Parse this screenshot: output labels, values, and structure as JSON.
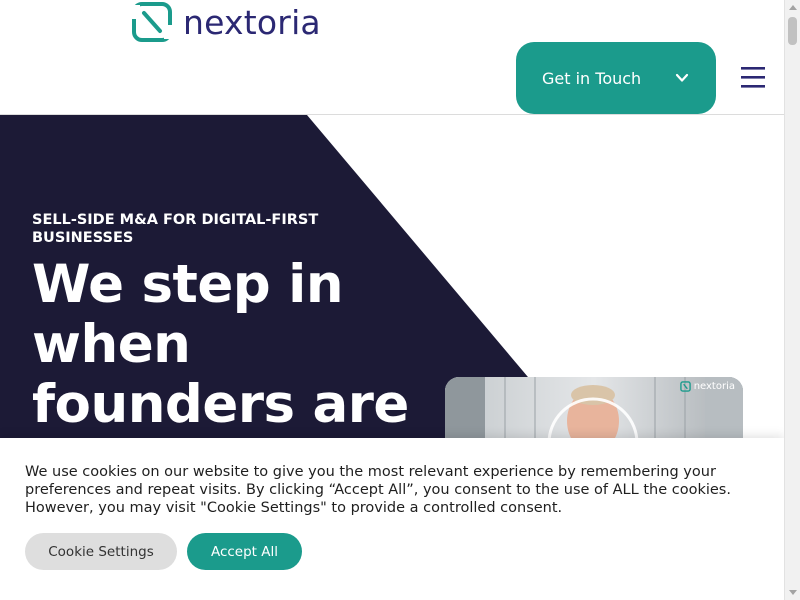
{
  "brand": {
    "name": "nextoria",
    "accent": "#1b9b8c",
    "navy": "#1c1a36",
    "wordmark_color": "#2b2873"
  },
  "header": {
    "cta_label": "Get in Touch",
    "cta_icon": "chevron-down-icon",
    "menu_icon": "hamburger-menu-icon"
  },
  "hero": {
    "eyebrow": "SELL-SIDE M&A FOR DIGITAL-FIRST BUSINESSES",
    "headline": "We step in when founders are",
    "video_brand": "nextoria"
  },
  "cookie_banner": {
    "text": "We use cookies on our website to give you the most relevant experience by remembering your preferences and repeat visits. By clicking “Accept All”, you consent to the use of ALL the cookies. However, you may visit \"Cookie Settings\" to provide a controlled consent.",
    "settings_label": "Cookie Settings",
    "accept_label": "Accept All"
  }
}
